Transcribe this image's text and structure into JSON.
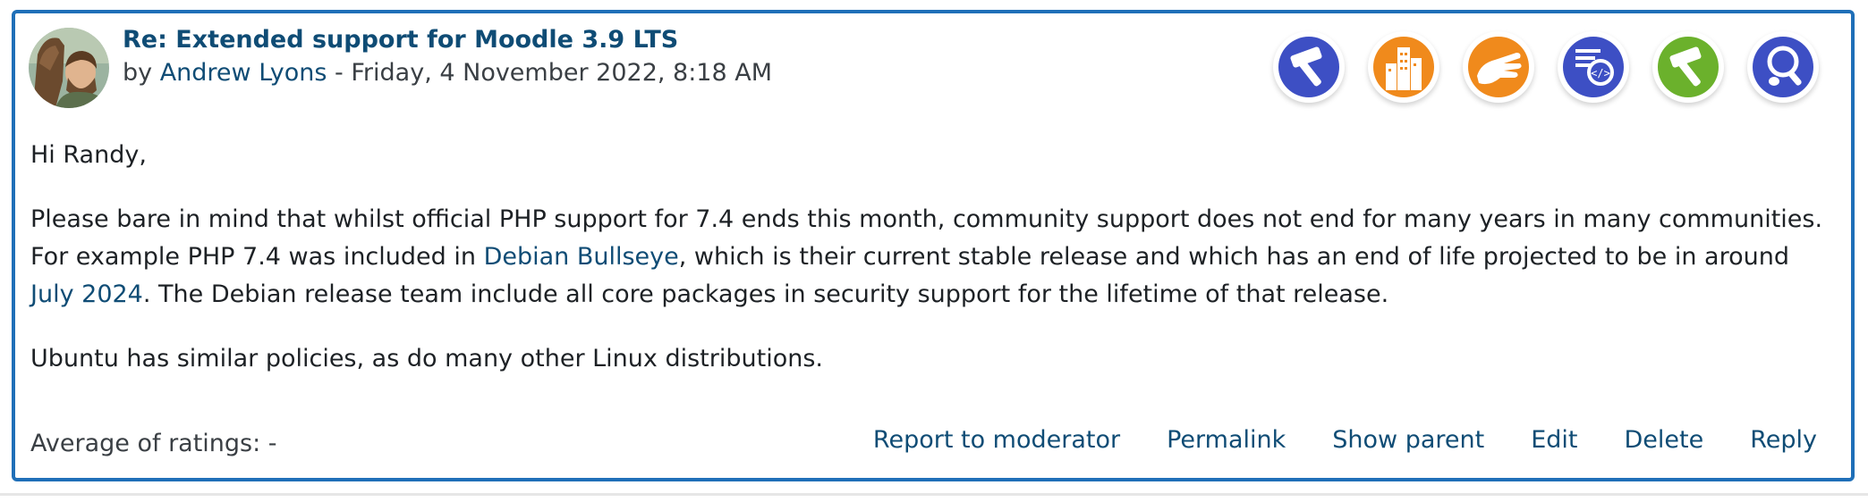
{
  "post": {
    "title": "Re: Extended support for Moodle 3.9 LTS",
    "by_prefix": "by ",
    "author": "Andrew Lyons",
    "date": " - Friday, 4 November 2022, 8:18 AM",
    "badges": [
      {
        "icon": "hammer-icon",
        "color": "#3d4fc4"
      },
      {
        "icon": "buildings-icon",
        "color": "#f08a1c"
      },
      {
        "icon": "hand-icon",
        "color": "#f08a1c"
      },
      {
        "icon": "code-document-icon",
        "color": "#3d4fc4"
      },
      {
        "icon": "hammer-icon",
        "color": "#6bb12c"
      },
      {
        "icon": "magnifier-bug-icon",
        "color": "#3d4fc4"
      }
    ],
    "body": {
      "greeting": "Hi Randy,",
      "p2_part1": "Please bare in mind that whilst official PHP support for 7.4 ends this month, community support does not end for many years in many communities. For example PHP 7.4 was included in ",
      "link1": "Debian Bullseye",
      "p2_part2": ", which is their current stable release and which has an end of life projected to be in around ",
      "link2": "July 2024",
      "p2_part3": ". The Debian release team include all core packages in security support for the lifetime of that release.",
      "p3": "Ubuntu has similar policies, as do many other Linux distributions."
    },
    "ratings_label": "Average of ratings: -",
    "actions": {
      "report": "Report to moderator",
      "permalink": "Permalink",
      "show_parent": "Show parent",
      "edit": "Edit",
      "delete": "Delete",
      "reply": "Reply"
    }
  }
}
